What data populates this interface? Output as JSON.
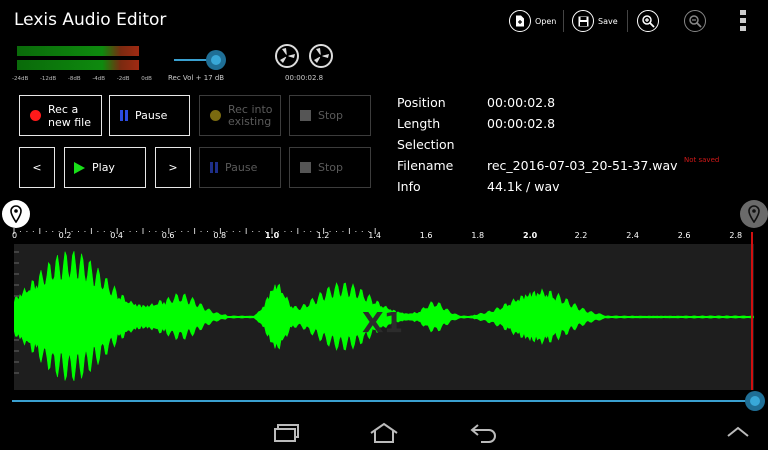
{
  "app": {
    "title": "Lexis Audio Editor"
  },
  "toolbar": {
    "open_label": "Open",
    "save_label": "Save"
  },
  "meter": {
    "scale": [
      "-24dB",
      "-12dB",
      "-8dB",
      "-4dB",
      "-2dB",
      "0dB"
    ],
    "levels": [
      0.97,
      0.97
    ]
  },
  "volume": {
    "label": "Rec Vol + 17 dB",
    "level": 0.85
  },
  "tape": {
    "time": "00:00:02.8"
  },
  "buttons": {
    "rec_new_label": "Rec a new file",
    "pause_label": "Pause",
    "rec_existing_label": "Rec into existing",
    "stop_label": "Stop",
    "prev_label": "<",
    "play_label": "Play",
    "next_label": ">",
    "pause2_label": "Pause",
    "stop2_label": "Stop"
  },
  "info": {
    "position_label": "Position",
    "position_value": "00:00:02.8",
    "length_label": "Length",
    "length_value": "00:00:02.8",
    "selection_label": "Selection",
    "selection_value": "",
    "filename_label": "Filename",
    "filename_value": "rec_2016-07-03_20-51-37.wav",
    "not_saved": "Not saved",
    "info_label": "Info",
    "info_value": "44.1k / wav"
  },
  "ruler": {
    "labels": [
      "0",
      "0.2",
      "0.4",
      "0.6",
      "0.8",
      "1.0",
      "1.2",
      "1.4",
      "1.6",
      "1.8",
      "2.0",
      "2.2",
      "2.4",
      "2.6",
      "2.8"
    ],
    "bold": [
      "1.0",
      "2.0"
    ]
  },
  "waveform": {
    "watermark": "X1",
    "color": "#00ff00"
  },
  "playback": {
    "position_fraction": 1.0
  },
  "colors": {
    "accent": "#3aa0d0",
    "record": "#ff1a1a",
    "play": "#19e019",
    "pause": "#2b4ce0",
    "playhead": "#d01010"
  }
}
